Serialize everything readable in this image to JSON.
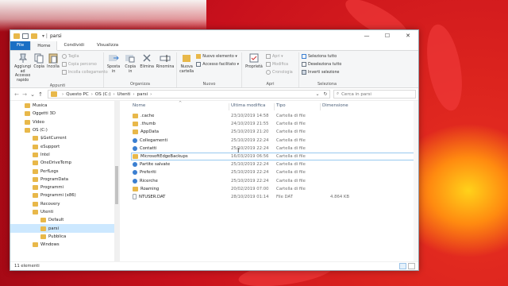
{
  "window": {
    "title": "parsi",
    "controls": {
      "minimize": "—",
      "maximize": "☐",
      "close": "✕"
    }
  },
  "ribbon_tabs": [
    "File",
    "Home",
    "Condividi",
    "Visualizza"
  ],
  "ribbon": {
    "appunti": {
      "label": "Appunti",
      "pin": "Aggiungi ad Accesso rapido",
      "copy": "Copia",
      "paste": "Incolla",
      "cut": "Taglia",
      "copy_path": "Copia percorso",
      "paste_shortcut": "Incolla collegamento"
    },
    "organizza": {
      "label": "Organizza",
      "move": "Sposta in",
      "copy_to": "Copia in",
      "delete": "Elimina",
      "rename": "Rinomina"
    },
    "nuovo": {
      "label": "Nuovo",
      "new_folder": "Nuova cartella",
      "new_item": "Nuovo elemento ▾",
      "easy_access": "Accesso facilitato ▾"
    },
    "apri": {
      "label": "Apri",
      "properties": "Proprietà",
      "open": "Apri ▾",
      "edit": "Modifica",
      "history": "Cronologia"
    },
    "seleziona": {
      "label": "Seleziona",
      "select_all": "Seleziona tutto",
      "select_none": "Deseleziona tutto",
      "invert": "Inverti selezione"
    }
  },
  "address": {
    "crumbs": [
      "Questo PC",
      "OS (C:)",
      "Utenti",
      "parsi"
    ],
    "search_placeholder": "Cerca in parsi"
  },
  "nav_items": [
    {
      "label": "Musica",
      "indent": 1,
      "selected": false
    },
    {
      "label": "Oggetti 3D",
      "indent": 1,
      "selected": false
    },
    {
      "label": "Video",
      "indent": 1,
      "selected": false
    },
    {
      "label": "OS (C:)",
      "indent": 1,
      "selected": false
    },
    {
      "label": "$GetCurrent",
      "indent": 2,
      "selected": false
    },
    {
      "label": "eSupport",
      "indent": 2,
      "selected": false
    },
    {
      "label": "Intel",
      "indent": 2,
      "selected": false
    },
    {
      "label": "OneDriveTemp",
      "indent": 2,
      "selected": false
    },
    {
      "label": "PerfLogs",
      "indent": 2,
      "selected": false
    },
    {
      "label": "ProgramData",
      "indent": 2,
      "selected": false
    },
    {
      "label": "Programmi",
      "indent": 2,
      "selected": false
    },
    {
      "label": "Programmi (x86)",
      "indent": 2,
      "selected": false
    },
    {
      "label": "Recovery",
      "indent": 2,
      "selected": false
    },
    {
      "label": "Utenti",
      "indent": 2,
      "selected": false
    },
    {
      "label": "Default",
      "indent": 3,
      "selected": false
    },
    {
      "label": "parsi",
      "indent": 3,
      "selected": true
    },
    {
      "label": "Pubblica",
      "indent": 3,
      "selected": false
    },
    {
      "label": "Windows",
      "indent": 2,
      "selected": false
    }
  ],
  "columns": {
    "name": "Nome",
    "date": "Ultima modifica",
    "type": "Tipo",
    "size": "Dimensione"
  },
  "files": [
    {
      "name": ".cache",
      "date": "23/10/2019 14:58",
      "type": "Cartella di file",
      "size": "",
      "icon": "folder"
    },
    {
      "name": ".thumb",
      "date": "24/10/2019 21:55",
      "type": "Cartella di file",
      "size": "",
      "icon": "folder"
    },
    {
      "name": "AppData",
      "date": "25/10/2019 21:20",
      "type": "Cartella di file",
      "size": "",
      "icon": "folder"
    },
    {
      "name": "Collegamenti",
      "date": "25/10/2019 22:24",
      "type": "Cartella di file",
      "size": "",
      "icon": "special"
    },
    {
      "name": "Contatti",
      "date": "25/10/2019 22:24",
      "type": "Cartella di file",
      "size": "",
      "icon": "special"
    },
    {
      "name": "MicrosoftEdgeBackups",
      "date": "16/03/2019 06:56",
      "type": "Cartella di file",
      "size": "",
      "icon": "folder",
      "focus": true
    },
    {
      "name": "Partite salvate",
      "date": "25/10/2019 22:24",
      "type": "Cartella di file",
      "size": "",
      "icon": "special"
    },
    {
      "name": "Preferiti",
      "date": "25/10/2019 22:24",
      "type": "Cartella di file",
      "size": "",
      "icon": "special"
    },
    {
      "name": "Ricerche",
      "date": "25/10/2019 22:24",
      "type": "Cartella di file",
      "size": "",
      "icon": "special"
    },
    {
      "name": "Roaming",
      "date": "20/02/2019 07:00",
      "type": "Cartella di file",
      "size": "",
      "icon": "folder"
    },
    {
      "name": "NTUSER.DAT",
      "date": "28/10/2019 01:14",
      "type": "File DAT",
      "size": "4.864 KB",
      "icon": "file"
    }
  ],
  "status": {
    "count": "11 elementi"
  }
}
